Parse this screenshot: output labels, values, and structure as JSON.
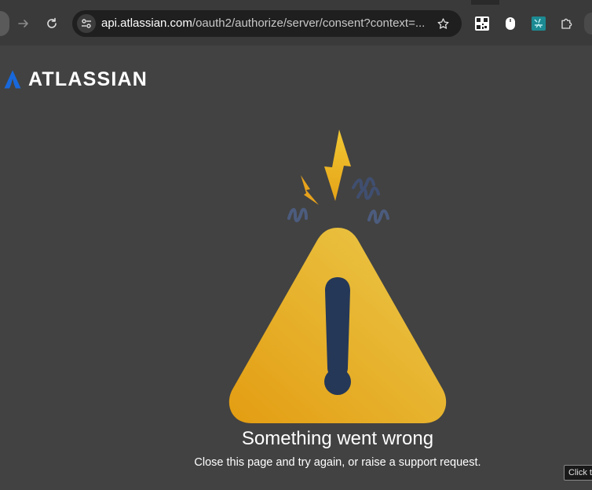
{
  "browser": {
    "url_host": "api.atlassian.com",
    "url_path": "/oauth2/authorize/server/consent?context=..."
  },
  "brand": {
    "name": "ATLASSIAN",
    "color": "#1868DB"
  },
  "error": {
    "title": "Something went wrong",
    "message": "Close this page and try again, or raise a support request."
  },
  "tooltip": {
    "text": "Click t"
  },
  "icons": {
    "back": "back-arrow-icon",
    "forward": "forward-arrow-icon",
    "reload": "reload-icon",
    "site_info": "tune-icon",
    "bookmark": "star-icon",
    "extensions": [
      "qr-code-icon",
      "mouse-icon",
      "teal-extension-icon",
      "puzzle-icon"
    ],
    "illustration": "warning-triangle-icon"
  },
  "colors": {
    "page_background": "#424242",
    "warning_yellow": "#E9B824",
    "exclamation": "#253858"
  }
}
